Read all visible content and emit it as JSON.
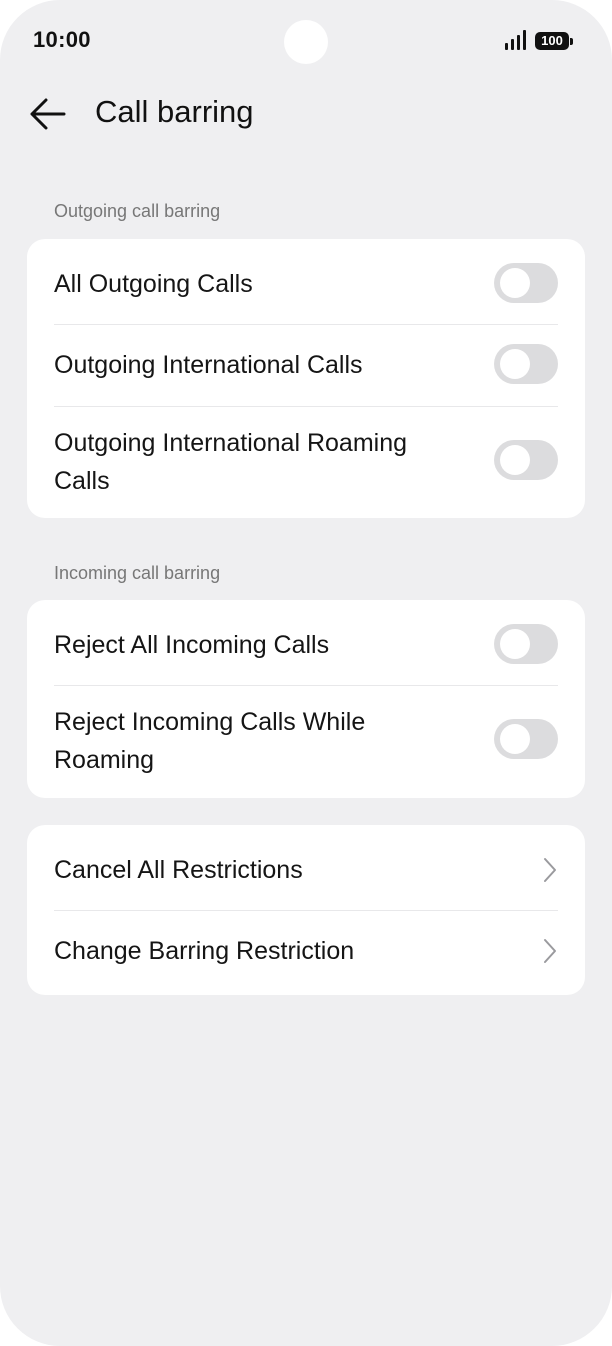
{
  "status_bar": {
    "time": "10:00",
    "battery": "100"
  },
  "header": {
    "title": "Call barring"
  },
  "outgoing": {
    "section_label": "Outgoing call barring",
    "items": [
      {
        "label": "All Outgoing Calls",
        "enabled": false
      },
      {
        "label": "Outgoing International Calls",
        "enabled": false
      },
      {
        "label": "Outgoing International Roaming Calls",
        "enabled": false
      }
    ]
  },
  "incoming": {
    "section_label": "Incoming call barring",
    "items": [
      {
        "label": "Reject All Incoming Calls",
        "enabled": false
      },
      {
        "label": "Reject Incoming Calls While Roaming",
        "enabled": false
      }
    ]
  },
  "actions": {
    "items": [
      {
        "label": "Cancel All Restrictions"
      },
      {
        "label": "Change Barring Restriction"
      }
    ]
  },
  "icons": {
    "back": "arrow-left-icon",
    "chevron": "chevron-right-icon",
    "signal": "signal-icon"
  },
  "colors": {
    "background": "#efeff1",
    "card": "#ffffff",
    "toggle_off": "#dcdcde",
    "text": "#151515",
    "secondary_text": "#777777"
  }
}
